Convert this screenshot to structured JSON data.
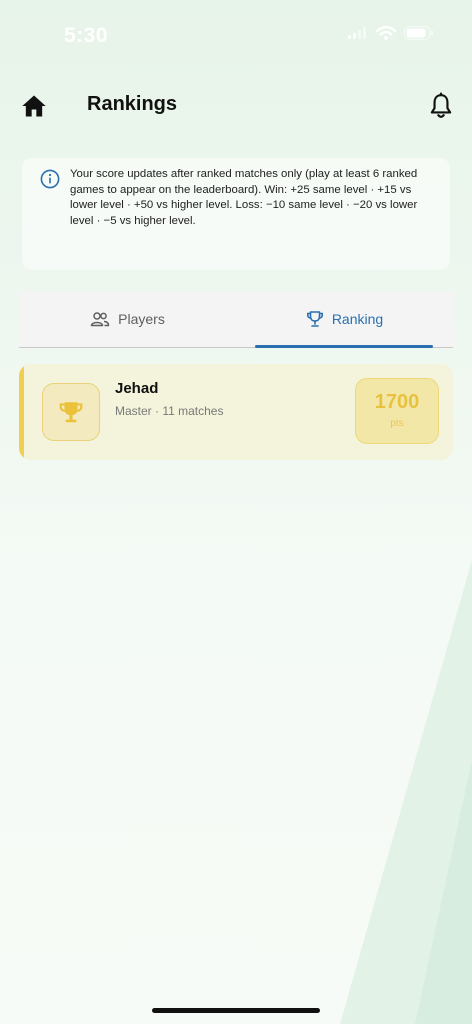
{
  "status_bar": {
    "time": "5:30"
  },
  "header": {
    "title": "Rankings"
  },
  "info": {
    "text": "Your score updates after ranked matches only (play at least 6 ranked games to appear on the leaderboard). Win: +25 same level · +15 vs lower level · +50 vs higher level. Loss: −10 same level · −20 vs lower level · −5 vs higher level."
  },
  "tabs": {
    "players_label": "Players",
    "ranking_label": "Ranking",
    "active": "Ranking"
  },
  "ranking": [
    {
      "name": "Jehad",
      "meta": "Master · 11 matches",
      "points": "1700",
      "points_unit": "pts"
    }
  ],
  "colors": {
    "accent": "#2a6fb0",
    "gold": "#efcf52",
    "card_bg": "#f4f4dc"
  },
  "icons": [
    "home-icon",
    "bell-icon",
    "info-icon",
    "people-icon",
    "trophy-icon",
    "signal-icon",
    "wifi-icon",
    "battery-icon"
  ]
}
